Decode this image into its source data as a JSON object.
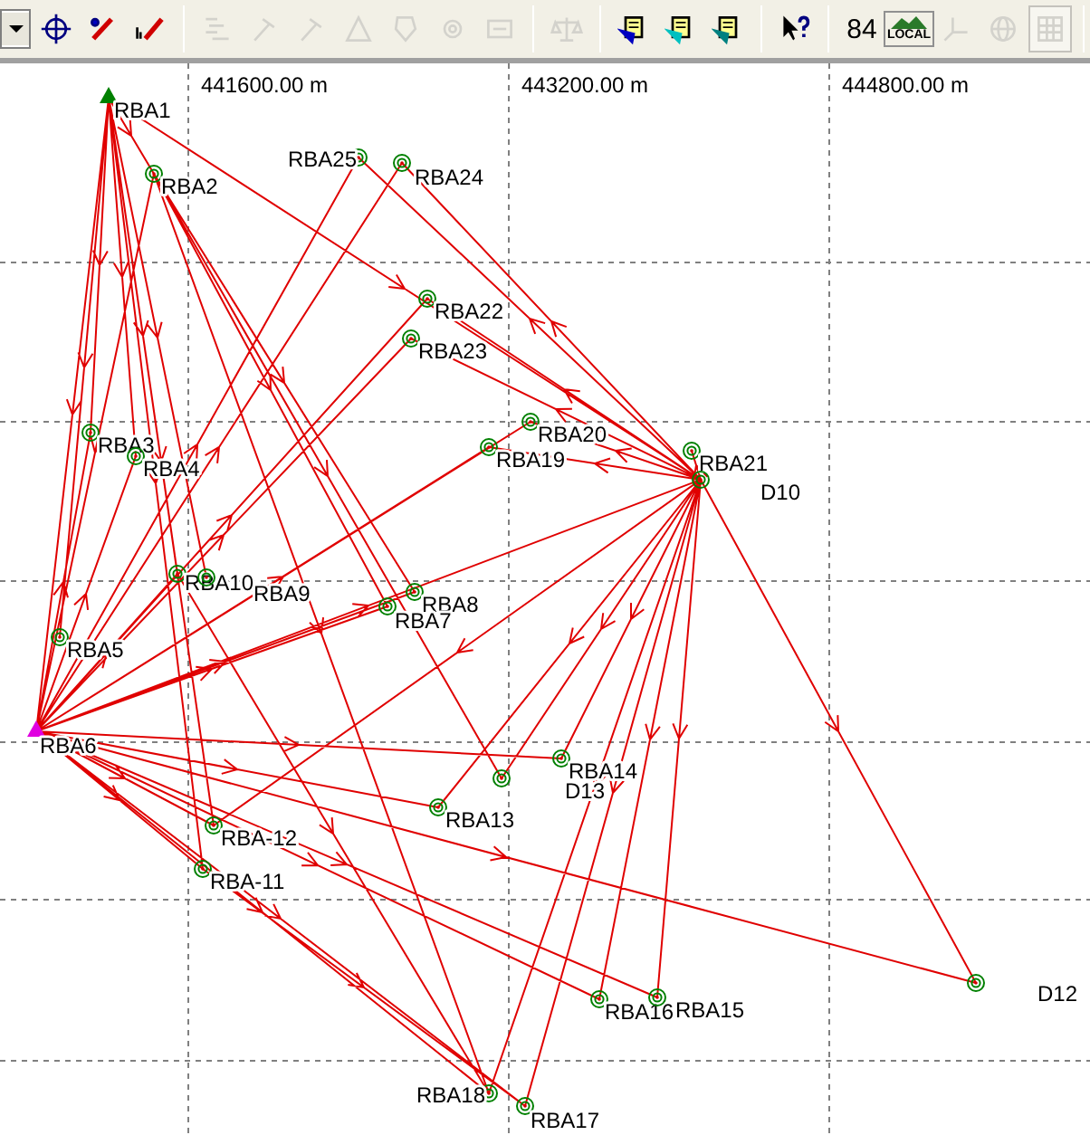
{
  "toolbar": {
    "groups": [
      [
        {
          "kind": "dropdown"
        },
        {
          "kind": "target",
          "disabled": false,
          "pressed": false
        },
        {
          "kind": "pen",
          "disabled": false,
          "pressed": false
        },
        {
          "kind": "pen-in",
          "disabled": false,
          "pressed": false
        }
      ],
      [
        {
          "kind": "lines",
          "disabled": true,
          "pressed": false
        },
        {
          "kind": "hammer",
          "disabled": true,
          "pressed": false
        },
        {
          "kind": "hammer",
          "disabled": true,
          "pressed": false
        },
        {
          "kind": "triangle",
          "disabled": true,
          "pressed": false
        },
        {
          "kind": "shield",
          "disabled": true,
          "pressed": false
        },
        {
          "kind": "gear",
          "disabled": true,
          "pressed": false
        },
        {
          "kind": "panel",
          "disabled": true,
          "pressed": false
        }
      ],
      [
        {
          "kind": "scale",
          "disabled": true,
          "pressed": false
        }
      ],
      [
        {
          "kind": "docs",
          "color": "#0000c0",
          "disabled": false,
          "pressed": false
        },
        {
          "kind": "docs",
          "color": "#00c0c0",
          "disabled": false,
          "pressed": false
        },
        {
          "kind": "docs",
          "color": "#008080",
          "disabled": false,
          "pressed": false
        }
      ],
      [
        {
          "kind": "help",
          "disabled": false,
          "pressed": false
        }
      ],
      [
        {
          "kind": "number",
          "text": "84",
          "disabled": false,
          "pressed": false
        },
        {
          "kind": "local",
          "text": "LOCAL",
          "disabled": false,
          "pressed": false
        },
        {
          "kind": "axes",
          "disabled": true,
          "pressed": false
        },
        {
          "kind": "globe",
          "disabled": true,
          "pressed": false
        },
        {
          "kind": "grid",
          "disabled": true,
          "pressed": true
        }
      ],
      [
        {
          "kind": "field"
        }
      ]
    ]
  },
  "map": {
    "axis_labels": [
      "441600.00 m",
      "443200.00 m",
      "444800.00 m"
    ],
    "points": [
      {
        "label": "RBA1",
        "kind": "control"
      },
      {
        "label": "RBA2",
        "kind": "station"
      },
      {
        "label": "RBA25",
        "kind": "station"
      },
      {
        "label": "RBA24",
        "kind": "station"
      },
      {
        "label": "RBA22",
        "kind": "station"
      },
      {
        "label": "RBA23",
        "kind": "station"
      },
      {
        "label": "RBA20",
        "kind": "station"
      },
      {
        "label": "RBA19",
        "kind": "station"
      },
      {
        "label": "RBA21",
        "kind": "station"
      },
      {
        "label": "D10",
        "kind": "station"
      },
      {
        "label": "RBA3",
        "kind": "station"
      },
      {
        "label": "RBA4",
        "kind": "station"
      },
      {
        "label": "RBA10",
        "kind": "station"
      },
      {
        "label": "RBA9",
        "kind": "station"
      },
      {
        "label": "RBA8",
        "kind": "station"
      },
      {
        "label": "RBA7",
        "kind": "station"
      },
      {
        "label": "RBA5",
        "kind": "station"
      },
      {
        "label": "RBA6",
        "kind": "fixed"
      },
      {
        "label": "RBA14",
        "kind": "station"
      },
      {
        "label": "D13",
        "kind": "station"
      },
      {
        "label": "RBA13",
        "kind": "station"
      },
      {
        "label": "RBA-12",
        "kind": "station"
      },
      {
        "label": "RBA-11",
        "kind": "station"
      },
      {
        "label": "D12",
        "kind": "station"
      },
      {
        "label": "RBA16",
        "kind": "station"
      },
      {
        "label": "RBA15",
        "kind": "station"
      },
      {
        "label": "RBA18",
        "kind": "station"
      },
      {
        "label": "RBA17",
        "kind": "station"
      }
    ]
  }
}
